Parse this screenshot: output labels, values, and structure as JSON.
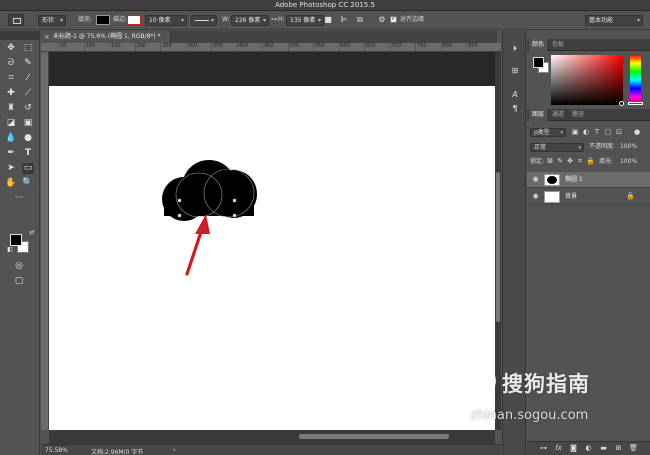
{
  "app": {
    "title": "Adobe Photoshop CC 2015.5"
  },
  "options_bar": {
    "tool_mode": "形状",
    "fill_label": "填充:",
    "stroke_label": "描边:",
    "stroke_width": "10 像素",
    "width_label": "W:",
    "width_value": "226 像素",
    "height_label": "H:",
    "height_value": "135 像素",
    "align_edges_label": "对齐边缘",
    "workspace": "基本功能",
    "fill_color": "#000000",
    "stroke_color": "#cc2020"
  },
  "document": {
    "tab_title": "未标题-1 @ 75.6% (椭圆 1, RGB/8*) *",
    "ruler_ticks": [
      "50",
      "100",
      "150",
      "200",
      "250",
      "300",
      "350",
      "400",
      "450",
      "500",
      "550",
      "600",
      "650",
      "700",
      "750",
      "800",
      "850"
    ],
    "zoom": "75.58%",
    "doc_info": "文档:2.96M/0 字节"
  },
  "panels": {
    "color_tabs": [
      "颜色",
      "色板"
    ],
    "layers_tabs": [
      "图层",
      "通道",
      "路径"
    ],
    "kind_filter": "ρ类型",
    "blend_mode": "正常",
    "opacity_label": "不透明度:",
    "opacity_value": "100%",
    "lock_label": "锁定:",
    "fill_label": "填充:",
    "fill_value": "100%",
    "layers": [
      {
        "name": "椭圆 1",
        "selected": true
      },
      {
        "name": "背景",
        "selected": false
      }
    ]
  },
  "watermark": {
    "text": "搜狗指南",
    "url": "zhinan.sogou.com"
  },
  "colors": {
    "accent_arrow": "#cc1e22",
    "canvas": "#ffffff",
    "shape": "#000000"
  }
}
